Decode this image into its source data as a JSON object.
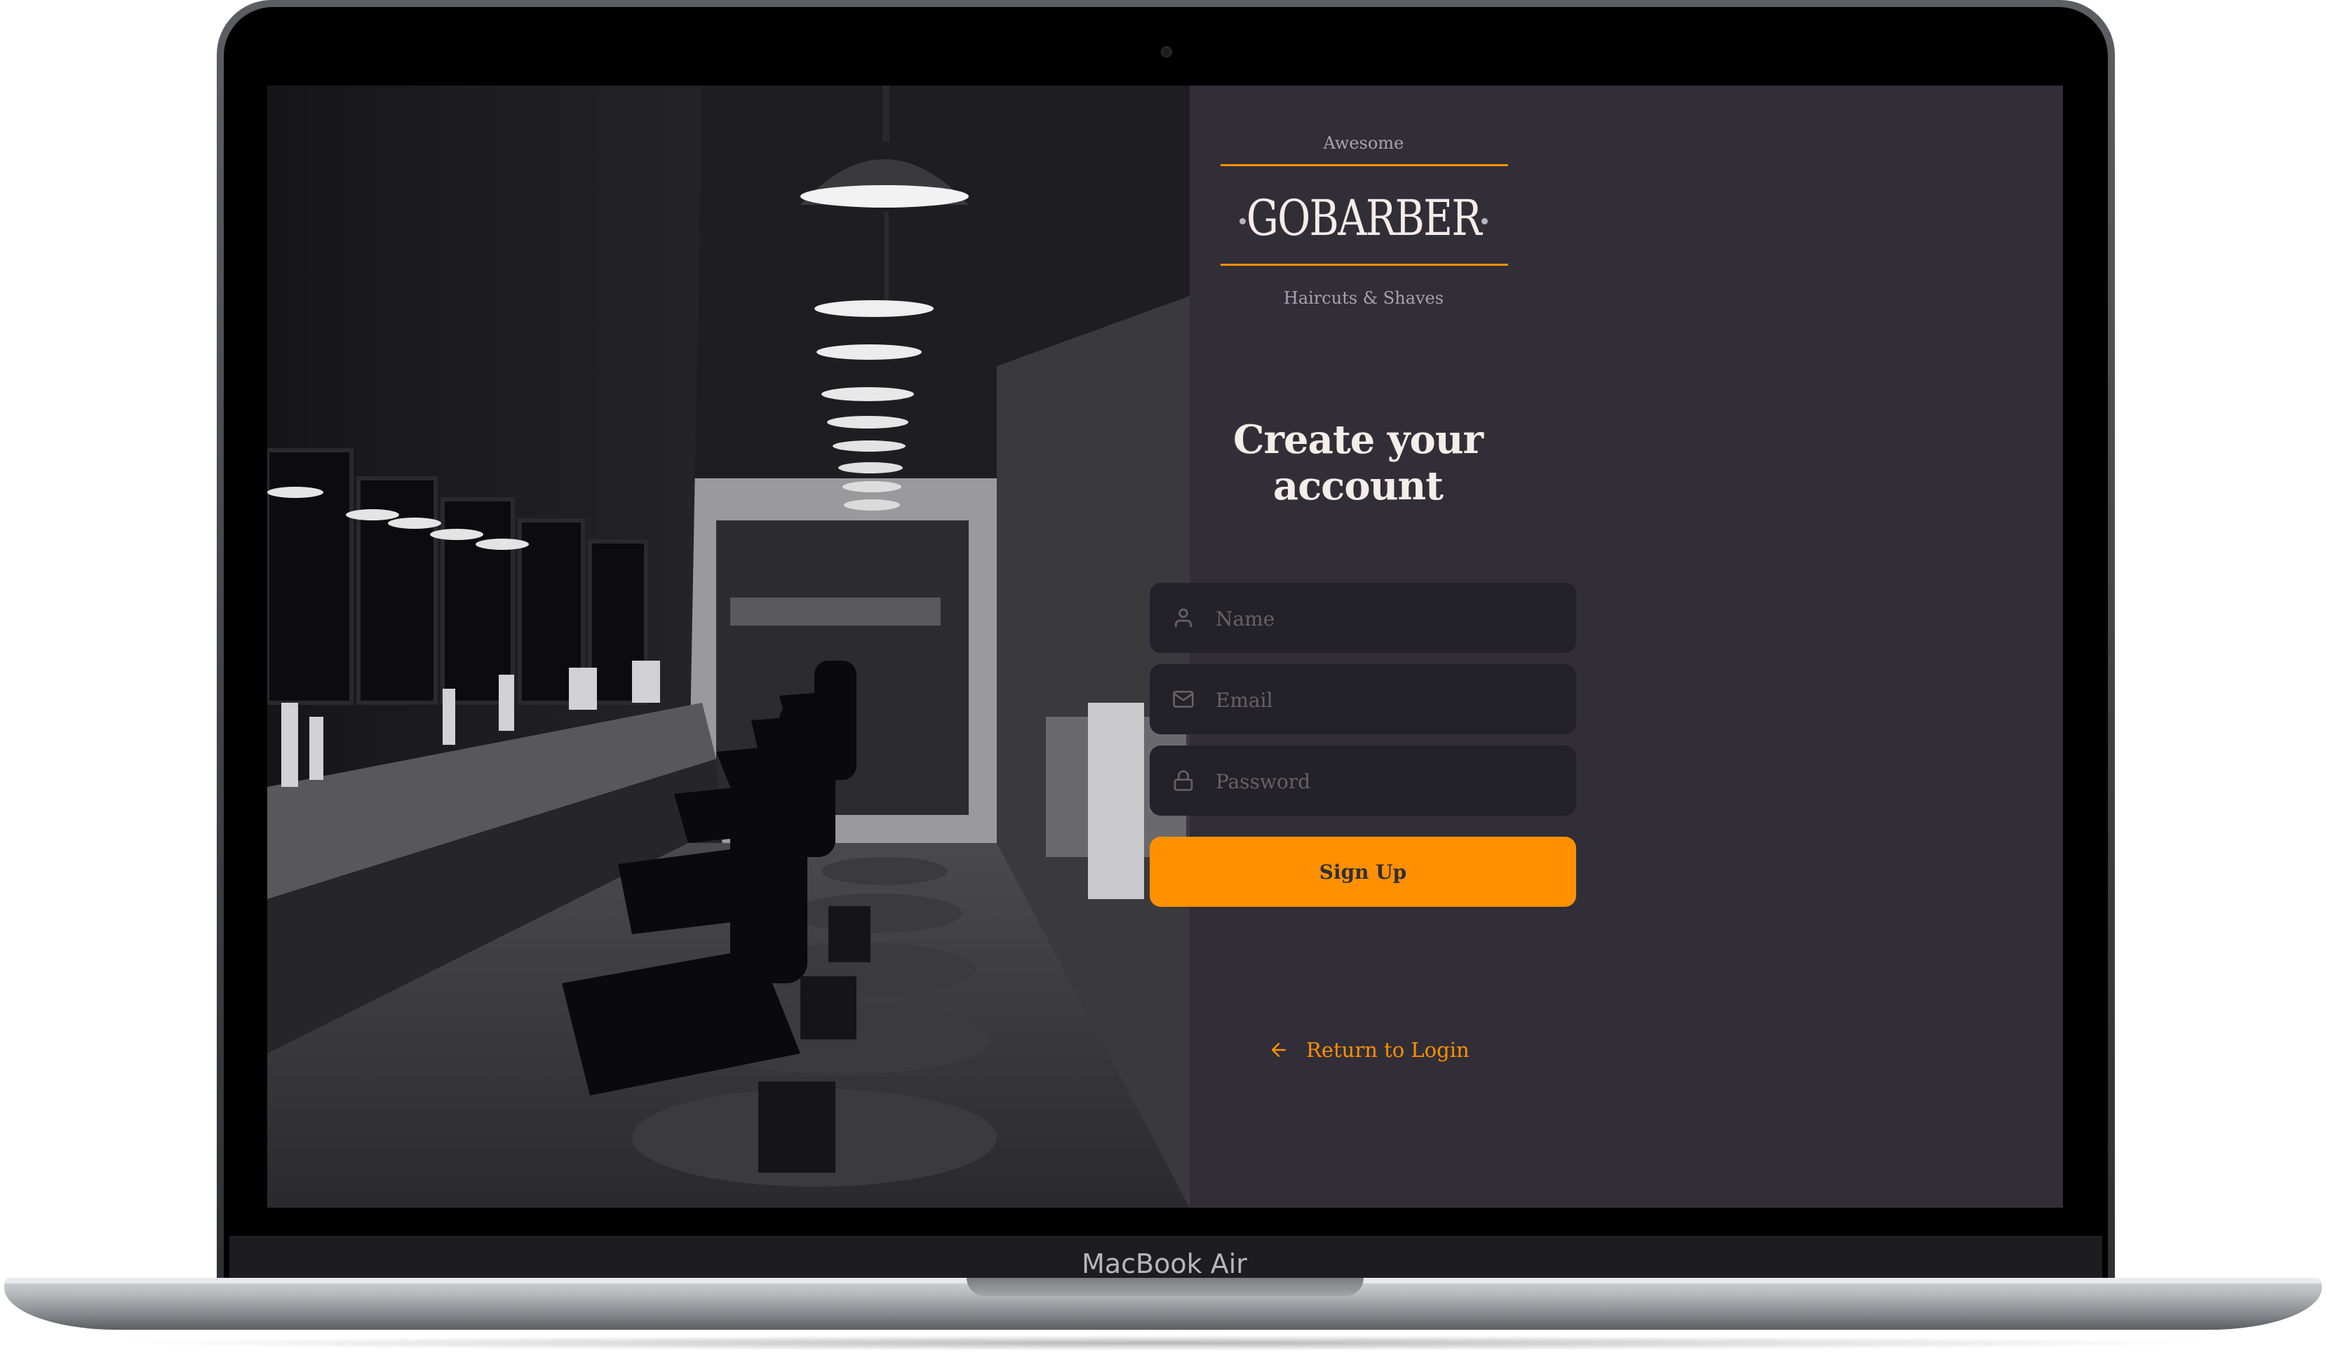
{
  "device": {
    "model_label": "MacBook Air"
  },
  "logo": {
    "top_text": "Awesome",
    "brand": "GOBARBER",
    "tagline": "Haircuts & Shaves",
    "accent_color": "#ff9000"
  },
  "form": {
    "title": "Create your account",
    "fields": [
      {
        "name": "name",
        "icon": "user-icon",
        "placeholder": "Name",
        "value": ""
      },
      {
        "name": "email",
        "icon": "mail-icon",
        "placeholder": "Email",
        "value": ""
      },
      {
        "name": "password",
        "icon": "lock-icon",
        "placeholder": "Password",
        "value": ""
      }
    ],
    "submit_label": "Sign Up",
    "back_link": {
      "icon": "arrow-left-icon",
      "label": "Return to Login"
    }
  },
  "theme": {
    "background": "#312e38",
    "input_background": "#232129",
    "primary": "#ff9000",
    "text": "#f4ede8",
    "placeholder": "#666360"
  }
}
